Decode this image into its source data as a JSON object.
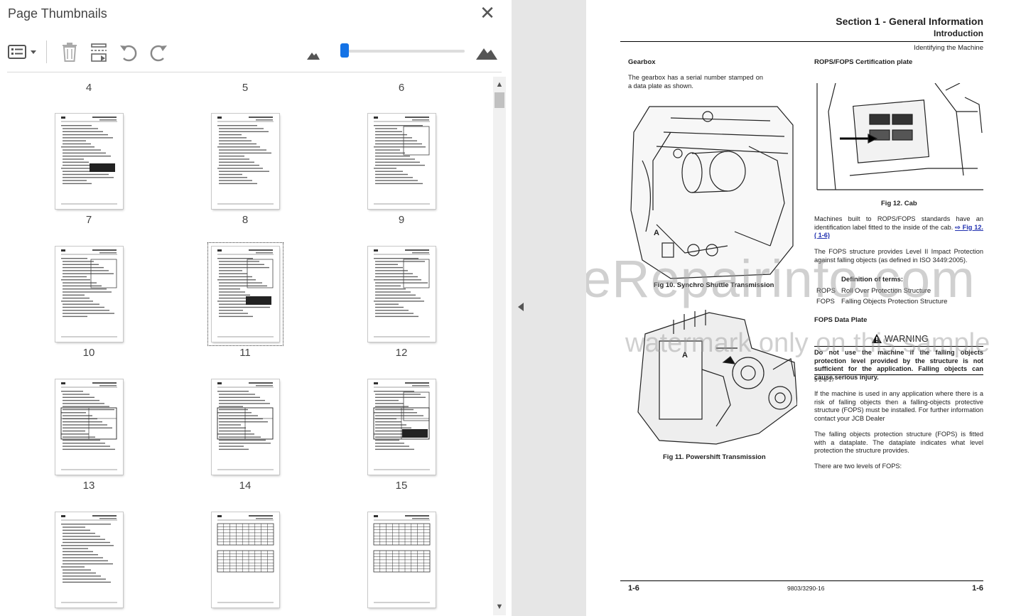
{
  "sidebar": {
    "title": "Page Thumbnails",
    "close_label": "✕",
    "toolbar": {
      "options_icon": "thumbnail-options-icon",
      "delete_icon": "trash-icon",
      "insert_icon": "insert-page-icon",
      "rotate_ccw_icon": "rotate-left-icon",
      "rotate_cw_icon": "rotate-right-icon",
      "zoom_out_icon": "small-mountain-icon",
      "zoom_in_icon": "large-mountain-icon",
      "zoom_level": 0.02
    },
    "scroll_up": "▲",
    "scroll_down": "▼",
    "top_labels": [
      "4",
      "5",
      "6"
    ],
    "rows": [
      {
        "pages": [
          "7",
          "8",
          "9"
        ]
      },
      {
        "pages": [
          "10",
          "11",
          "12"
        ]
      },
      {
        "pages": [
          "13",
          "14",
          "15"
        ]
      },
      {
        "pages": [
          "",
          "",
          ""
        ]
      }
    ],
    "selected_page": "11"
  },
  "document": {
    "section_title": "Section 1 - General Information",
    "subsection": "Introduction",
    "topic": "Identifying the Machine",
    "gearbox_heading": "Gearbox",
    "gearbox_text": "The gearbox has a serial number stamped on a data plate as shown.",
    "fig10_label_a": "A",
    "fig10_caption": "Fig 10. Synchro Shuttle Transmission",
    "fig11_label_a": "A",
    "fig11_caption": "Fig 11. Powershift Transmission",
    "rops_heading": "ROPS/FOPS Certification plate",
    "fig12_caption": "Fig 12. Cab",
    "rops_text": "Machines built to ROPS/FOPS standards have an identification label fitted to the inside of the cab.",
    "rops_xref": "⇨ Fig 12. ( 1-6)",
    "fops_text": "The FOPS structure provides Level II Impact Protection against falling objects (as defined in ISO 3449:2005).",
    "definition_heading": "Definition of terms:",
    "terms": [
      {
        "abbr": "ROPS",
        "meaning": "Roll Over Protection Structure"
      },
      {
        "abbr": "FOPS",
        "meaning": "Falling Objects Protection Structure"
      }
    ],
    "fops_plate_heading": "FOPS Data Plate",
    "warning_title": "WARNING",
    "warning_text": "Do not use the machine if the falling objects protection level provided by the structure is not sufficient for the application. Falling objects can cause serious injury.",
    "warning_code": "9-2-8-17",
    "para_install": "If the machine is used in any application where there is a risk of falling objects then a falling-objects protective structure (FOPS) must be installed. For further information contact your JCB Dealer",
    "para_dataplate": "The falling objects protection structure (FOPS) is fitted with a dataplate. The dataplate indicates what level protection the structure provides.",
    "para_levels": "There are two levels of FOPS:",
    "footer_left": "1-6",
    "footer_center": "9803/3290-16",
    "footer_right": "1-6",
    "watermark_main": "eRepairinfo.com",
    "watermark_sub": "watermark only on this sample"
  }
}
